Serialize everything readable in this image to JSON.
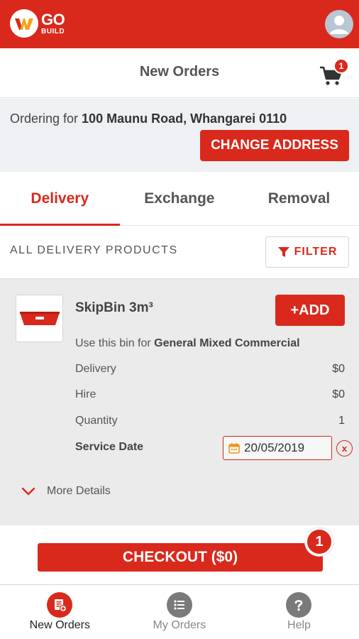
{
  "app": {
    "logo_go": "GO",
    "logo_build": "BUILD",
    "brand_color": "#d9291c"
  },
  "header": {
    "title": "New Orders",
    "cart_count": "1"
  },
  "address": {
    "prefix": "Ordering for ",
    "value": "100 Maunu Road, Whangarei 0110",
    "change_label": "CHANGE ADDRESS"
  },
  "tabs": [
    {
      "label": "Delivery",
      "active": true
    },
    {
      "label": "Exchange",
      "active": false
    },
    {
      "label": "Removal",
      "active": false
    }
  ],
  "products": {
    "section_label": "ALL DELIVERY PRODUCTS",
    "filter_label": "FILTER"
  },
  "product": {
    "name": "SkipBin 3m³",
    "add_label": "+ADD",
    "usage_prefix": "Use this bin for ",
    "usage_value": "General Mixed Commercial",
    "rows": [
      {
        "label": "Delivery",
        "value": "$0"
      },
      {
        "label": "Hire",
        "value": "$0"
      },
      {
        "label": "Quantity",
        "value": "1"
      }
    ],
    "service_date_label": "Service Date",
    "service_date_value": "20/05/2019",
    "clear_label": "x",
    "more_details_label": "More Details"
  },
  "checkout": {
    "label": "CHECKOUT ($0)",
    "badge": "1"
  },
  "bottom_nav": [
    {
      "label": "New Orders",
      "icon": "new-order-icon",
      "active": true
    },
    {
      "label": "My Orders",
      "icon": "list-icon",
      "active": false
    },
    {
      "label": "Help",
      "icon": "help-icon",
      "active": false
    }
  ]
}
